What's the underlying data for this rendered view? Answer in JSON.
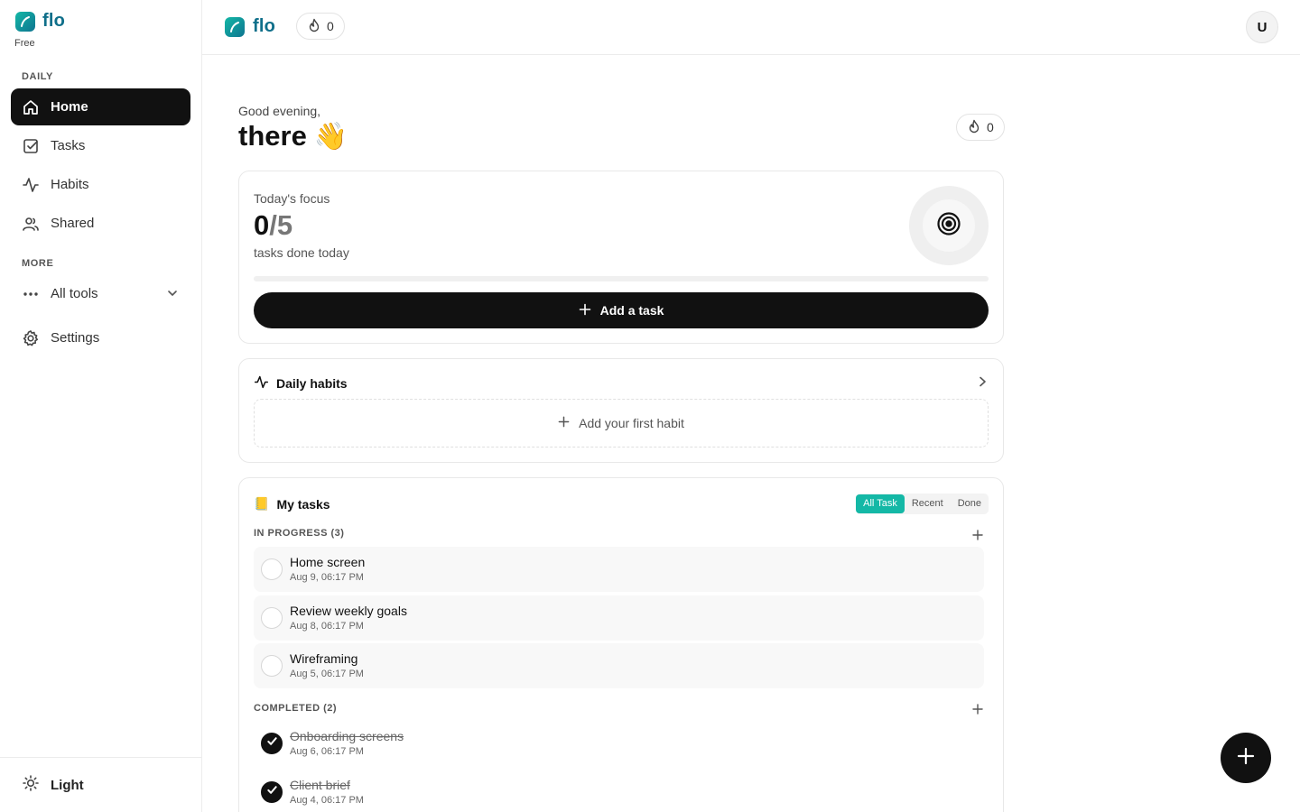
{
  "brand": {
    "name": "flo",
    "plan": "Free"
  },
  "sidebar": {
    "daily_label": "DAILY",
    "more_label": "MORE",
    "items": [
      {
        "label": "Home",
        "icon": "home-icon"
      },
      {
        "label": "Tasks",
        "icon": "checkbox-icon"
      },
      {
        "label": "Habits",
        "icon": "activity-icon"
      },
      {
        "label": "Shared",
        "icon": "users-icon"
      }
    ],
    "all_tools": "All tools",
    "settings": "Settings",
    "theme": "Light"
  },
  "topbar": {
    "streak": "0",
    "avatar_initial": "U"
  },
  "greeting": {
    "small": "Good evening,",
    "name": "there",
    "emoji": "👋",
    "streak": "0"
  },
  "focus": {
    "label": "Today's focus",
    "done": "0",
    "total": "/5",
    "subtitle": "tasks done today",
    "progress": 0,
    "add_button": "Add a task"
  },
  "habits": {
    "title": "Daily habits",
    "add_label": "Add your first habit"
  },
  "tasks": {
    "emoji": "📒",
    "title": "My tasks",
    "tabs": [
      "All Task",
      "Recent",
      "Done"
    ],
    "active_tab": "All Task",
    "in_progress_label": "IN PROGRESS (3)",
    "completed_label": "COMPLETED (2)",
    "in_progress": [
      {
        "title": "Home screen",
        "date": "Aug 9, 06:17 PM"
      },
      {
        "title": "Review weekly goals",
        "date": "Aug 8, 06:17 PM"
      },
      {
        "title": "Wireframing",
        "date": "Aug 5, 06:17 PM"
      }
    ],
    "completed": [
      {
        "title": "Onboarding screens",
        "date": "Aug 6, 06:17 PM"
      },
      {
        "title": "Client brief",
        "date": "Aug 4, 06:17 PM"
      }
    ]
  },
  "colors": {
    "accent": "#14b8a6",
    "brand": "#0f6f8a",
    "dark": "#111111"
  }
}
